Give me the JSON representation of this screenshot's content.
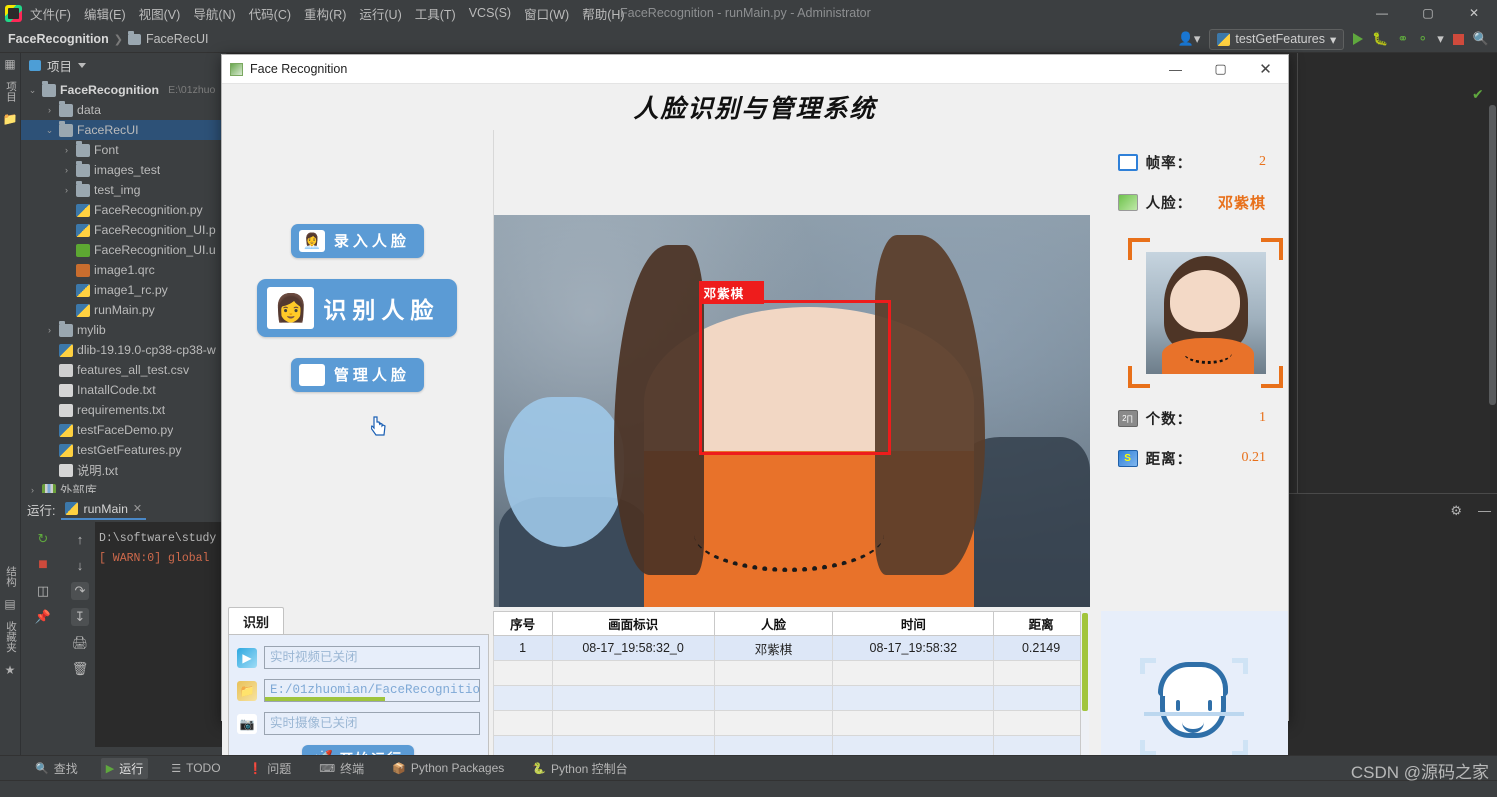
{
  "ide": {
    "window_title": "FaceRecognition - runMain.py - Administrator",
    "menu": [
      "文件(F)",
      "编辑(E)",
      "视图(V)",
      "导航(N)",
      "代码(C)",
      "重构(R)",
      "运行(U)",
      "工具(T)",
      "VCS(S)",
      "窗口(W)",
      "帮助(H)"
    ],
    "win_buttons": {
      "minimize": "—",
      "maximize": "▢",
      "close": "✕"
    },
    "breadcrumb": {
      "project": "FaceRecognition",
      "separator": "❯",
      "folder": "FaceRecUI"
    },
    "toolbar": {
      "run_config": "testGetFeatures",
      "run_config_caret": "▾",
      "profile_caret": "▾",
      "search_icon": "search-icon"
    },
    "left_rail": [
      "项目",
      "结构",
      "收藏夹"
    ],
    "project": {
      "header": "项目",
      "tree": [
        {
          "depth": 0,
          "arrow": "⌄",
          "icon": "folder",
          "label": "FaceRecognition",
          "bold": true,
          "path": "E:\\01zhuo",
          "selected": false
        },
        {
          "depth": 1,
          "arrow": "›",
          "icon": "folder",
          "label": "data",
          "bold": false,
          "path": "",
          "selected": false
        },
        {
          "depth": 1,
          "arrow": "⌄",
          "icon": "folder",
          "label": "FaceRecUI",
          "bold": false,
          "path": "",
          "selected": true
        },
        {
          "depth": 2,
          "arrow": "›",
          "icon": "folder",
          "label": "Font",
          "bold": false,
          "path": "",
          "selected": false
        },
        {
          "depth": 2,
          "arrow": "›",
          "icon": "folder",
          "label": "images_test",
          "bold": false,
          "path": "",
          "selected": false
        },
        {
          "depth": 2,
          "arrow": "›",
          "icon": "folder",
          "label": "test_img",
          "bold": false,
          "path": "",
          "selected": false
        },
        {
          "depth": 2,
          "arrow": "",
          "icon": "py",
          "label": "FaceRecognition.py",
          "bold": false,
          "path": "",
          "selected": false
        },
        {
          "depth": 2,
          "arrow": "",
          "icon": "py",
          "label": "FaceRecognition_UI.p",
          "bold": false,
          "path": "",
          "selected": false
        },
        {
          "depth": 2,
          "arrow": "",
          "icon": "qt",
          "label": "FaceRecognition_UI.u",
          "bold": false,
          "path": "",
          "selected": false
        },
        {
          "depth": 2,
          "arrow": "",
          "icon": "qrc",
          "label": "image1.qrc",
          "bold": false,
          "path": "",
          "selected": false
        },
        {
          "depth": 2,
          "arrow": "",
          "icon": "py",
          "label": "image1_rc.py",
          "bold": false,
          "path": "",
          "selected": false
        },
        {
          "depth": 2,
          "arrow": "",
          "icon": "py",
          "label": "runMain.py",
          "bold": false,
          "path": "",
          "selected": false
        },
        {
          "depth": 1,
          "arrow": "›",
          "icon": "folder",
          "label": "mylib",
          "bold": false,
          "path": "",
          "selected": false
        },
        {
          "depth": 1,
          "arrow": "",
          "icon": "py",
          "label": "dlib-19.19.0-cp38-cp38-w",
          "bold": false,
          "path": "",
          "selected": false
        },
        {
          "depth": 1,
          "arrow": "",
          "icon": "csv",
          "label": "features_all_test.csv",
          "bold": false,
          "path": "",
          "selected": false
        },
        {
          "depth": 1,
          "arrow": "",
          "icon": "txt",
          "label": "InatallCode.txt",
          "bold": false,
          "path": "",
          "selected": false
        },
        {
          "depth": 1,
          "arrow": "",
          "icon": "txt",
          "label": "requirements.txt",
          "bold": false,
          "path": "",
          "selected": false
        },
        {
          "depth": 1,
          "arrow": "",
          "icon": "py",
          "label": "testFaceDemo.py",
          "bold": false,
          "path": "",
          "selected": false
        },
        {
          "depth": 1,
          "arrow": "",
          "icon": "py",
          "label": "testGetFeatures.py",
          "bold": false,
          "path": "",
          "selected": false
        },
        {
          "depth": 1,
          "arrow": "",
          "icon": "txt",
          "label": "说明.txt",
          "bold": false,
          "path": "",
          "selected": false
        },
        {
          "depth": 0,
          "arrow": "›",
          "icon": "lib",
          "label": "外部库",
          "bold": false,
          "path": "",
          "selected": false
        }
      ]
    },
    "run_window": {
      "label": "运行:",
      "tab": "runMain",
      "tab_close": "✕",
      "console_lines": [
        {
          "text": "D:\\software\\study",
          "color": "white"
        },
        {
          "text": "[ WARN:0] global",
          "color": "red"
        }
      ]
    },
    "status_bar": [
      {
        "icon": "search-icon",
        "label": "查找",
        "active": false
      },
      {
        "icon": "run-icon",
        "label": "运行",
        "active": true
      },
      {
        "icon": "list-icon",
        "label": "TODO",
        "active": false
      },
      {
        "icon": "warning-icon",
        "label": "问题",
        "active": false
      },
      {
        "icon": "terminal-icon",
        "label": "终端",
        "active": false
      },
      {
        "icon": "packages-icon",
        "label": "Python Packages",
        "active": false
      },
      {
        "icon": "python-icon",
        "label": "Python 控制台",
        "active": false
      }
    ],
    "watermark": "CSDN @源码之家"
  },
  "dialog": {
    "title": "Face Recognition",
    "win_buttons": {
      "minimize": "—",
      "maximize": "▢",
      "close": "✕"
    },
    "heading": "人脸识别与管理系统",
    "buttons": [
      {
        "icon": "person-add-icon",
        "glyph": "👩‍💼",
        "label": "录入人脸",
        "size": "small"
      },
      {
        "icon": "face-scan-icon",
        "glyph": "👩",
        "label": "识别人脸",
        "size": "large"
      },
      {
        "icon": "face-manage-icon",
        "glyph": "🖼",
        "label": "管理人脸",
        "size": "small"
      }
    ],
    "video": {
      "detection_label": "邓紫棋"
    },
    "stats": [
      {
        "icon": "monitor-icon",
        "label": "帧率：",
        "value": "2",
        "type": "number"
      },
      {
        "icon": "image-icon",
        "label": "人脸：",
        "value": "邓紫棋",
        "type": "name"
      },
      {
        "icon": "count-icon",
        "label": "个数：",
        "value": "1",
        "type": "number"
      },
      {
        "icon": "distance-icon",
        "label": "距离：",
        "value": "0.21",
        "type": "number"
      }
    ],
    "panel": {
      "tab_label": "识别",
      "fields": [
        {
          "icon": "play-icon",
          "value": "",
          "placeholder": "实时视频已关闭",
          "progress": false
        },
        {
          "icon": "open-folder-icon",
          "value": "E:/01zhuomian/FaceRecognitio",
          "placeholder": "",
          "progress": true
        },
        {
          "icon": "webcam-icon",
          "value": "",
          "placeholder": "实时摄像已关闭",
          "progress": false
        }
      ],
      "run_button": {
        "icon": "rocket-icon",
        "glyph": "🚀",
        "label": "开始运行"
      }
    },
    "table": {
      "columns": [
        "序号",
        "画面标识",
        "人脸",
        "时间",
        "距离"
      ],
      "rows": [
        [
          "1",
          "08-17_19:58:32_0",
          "邓紫棋",
          "08-17_19:58:32",
          "0.2149"
        ],
        [
          "",
          "",
          "",
          "",
          ""
        ],
        [
          "",
          "",
          "",
          "",
          ""
        ],
        [
          "",
          "",
          "",
          "",
          ""
        ],
        [
          "",
          "",
          "",
          "",
          ""
        ],
        [
          "",
          "",
          "",
          "",
          ""
        ]
      ]
    },
    "face_placeholder_icon": "face-scan-placeholder-icon"
  },
  "colors": {
    "ide_bg": "#3c3f41",
    "console_bg": "#2b2b2b",
    "accent_blue": "#5b9bd5",
    "accent_orange": "#e8701a",
    "detect_red": "#ee1c1c",
    "selection_blue": "#2d5177",
    "progress_green": "#9fc43d"
  }
}
